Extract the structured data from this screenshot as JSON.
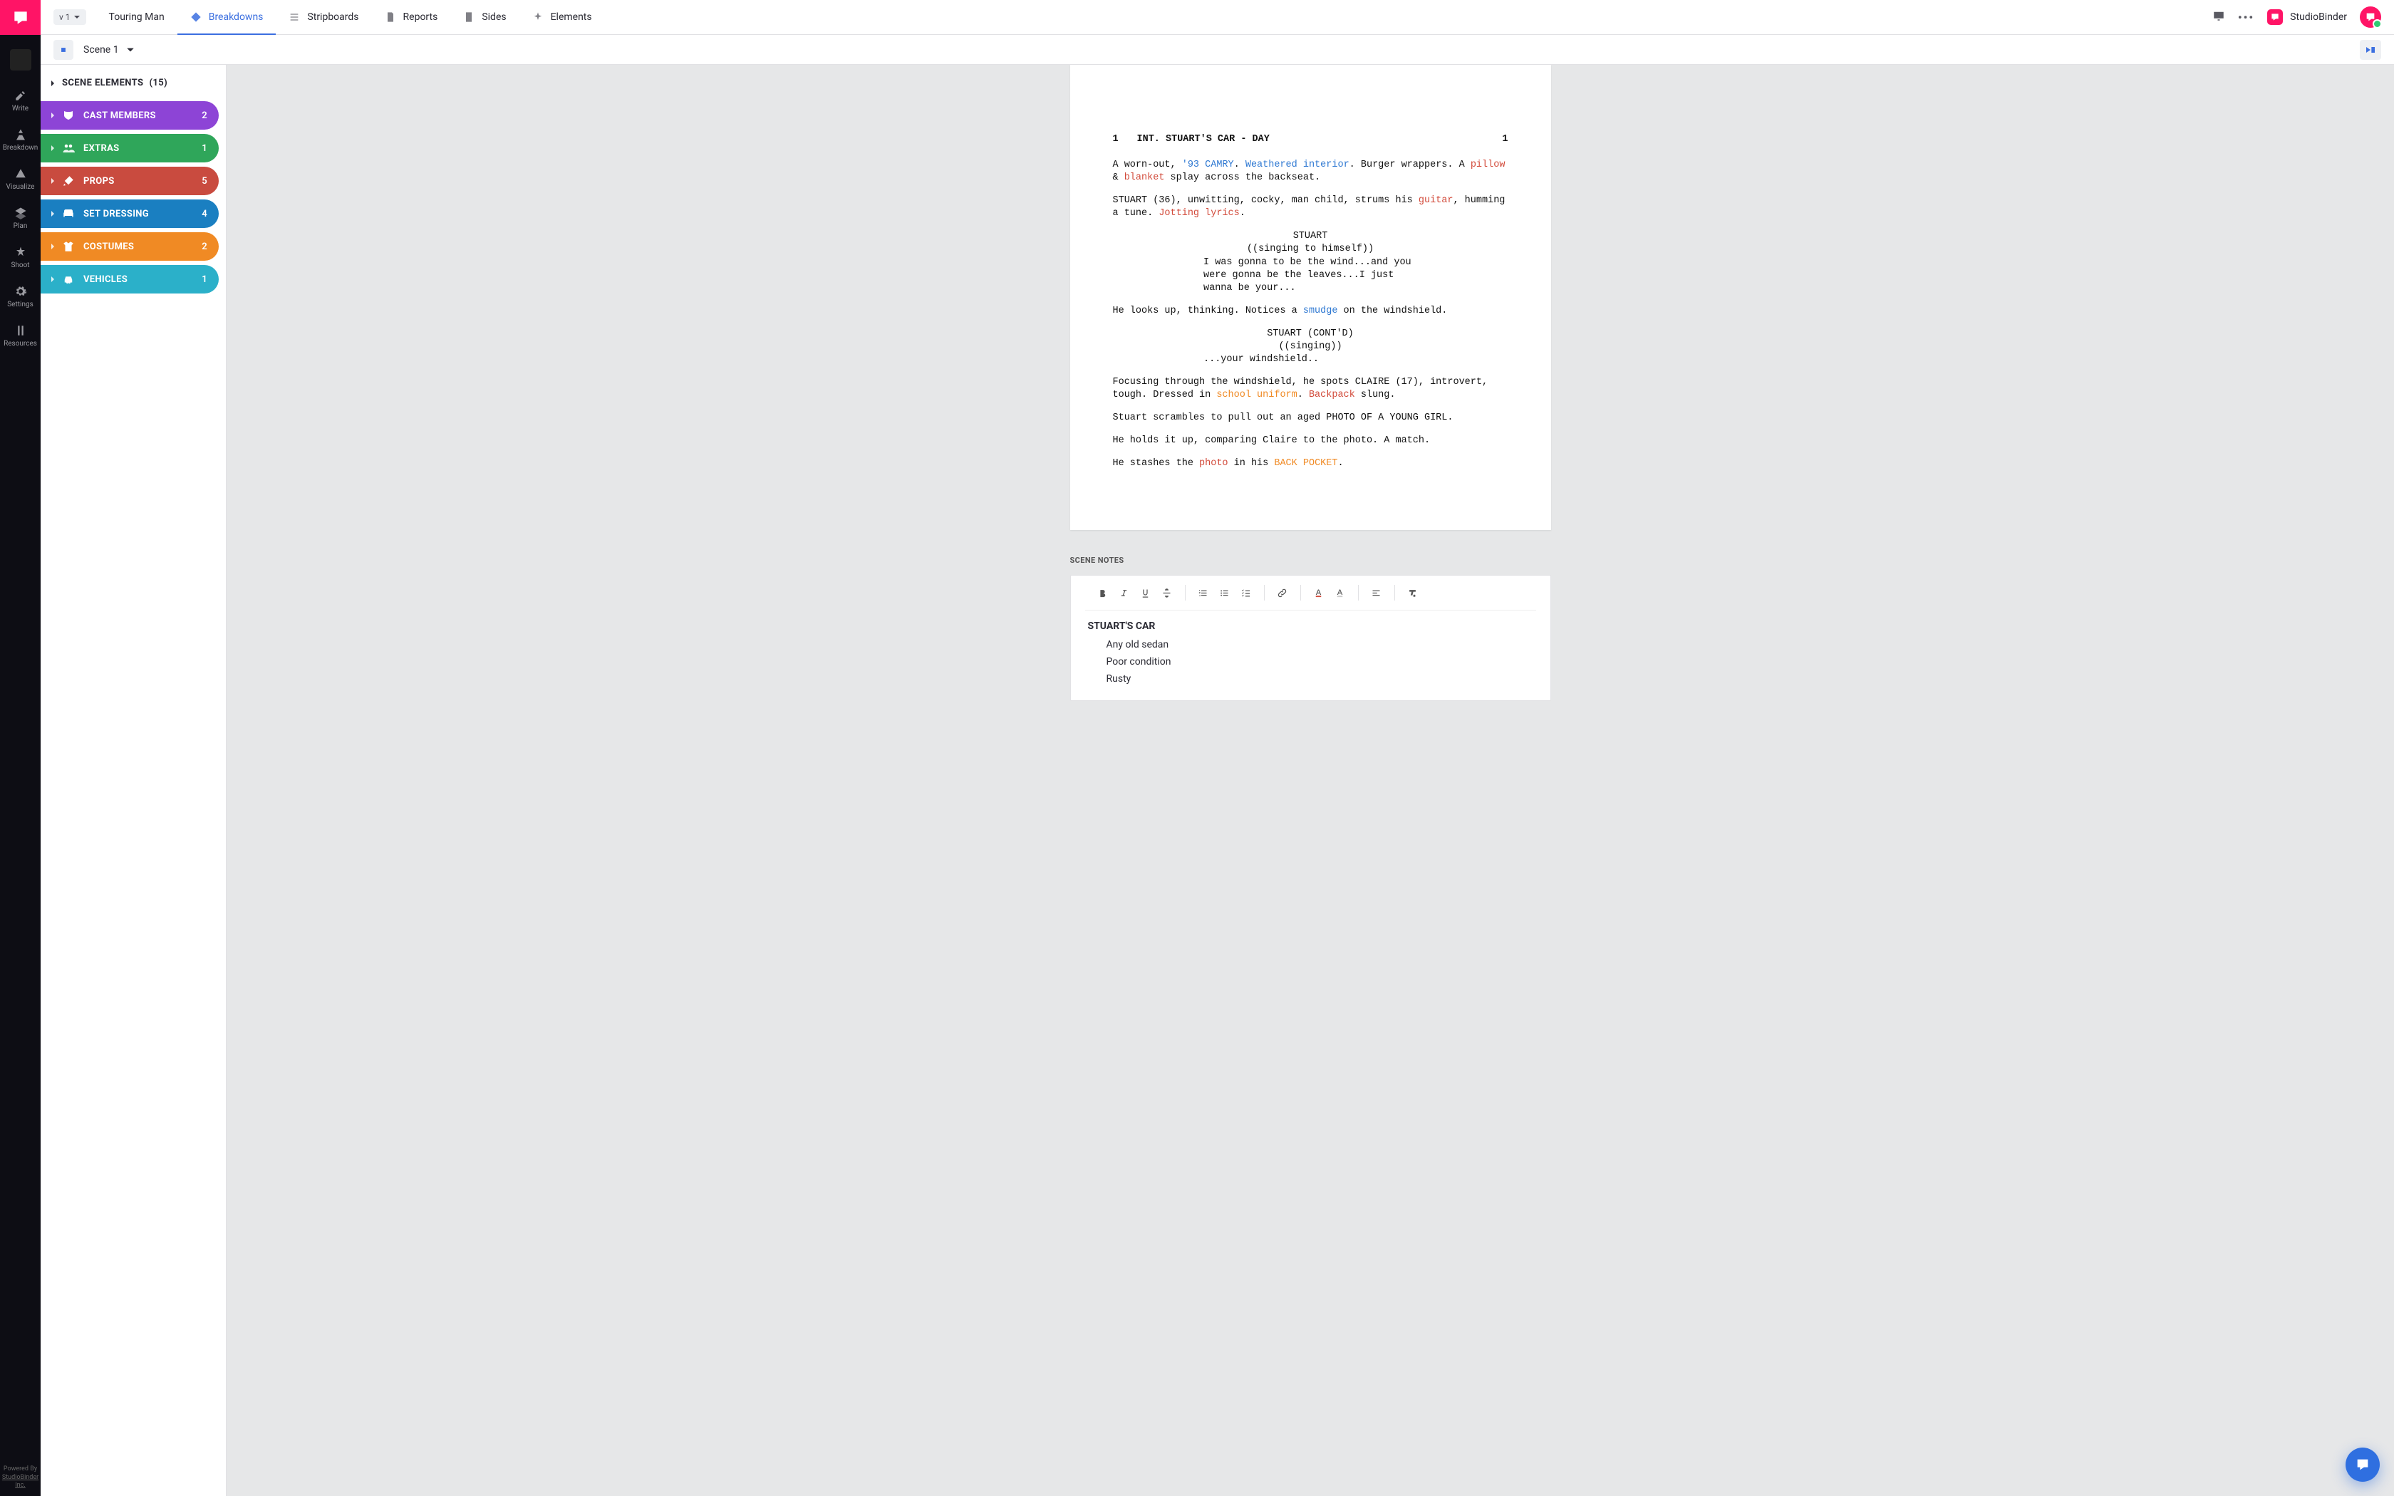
{
  "brand": {
    "name": "StudioBinder"
  },
  "rail": {
    "items": [
      {
        "label": "Write"
      },
      {
        "label": "Breakdown"
      },
      {
        "label": "Visualize"
      },
      {
        "label": "Plan"
      },
      {
        "label": "Shoot"
      },
      {
        "label": "Settings"
      },
      {
        "label": "Resources"
      }
    ],
    "footer_line1": "Powered By",
    "footer_line2": "StudioBinder Inc."
  },
  "topnav": {
    "version_label": "v 1",
    "project_title": "Touring Man",
    "tabs": [
      {
        "label": "Breakdowns"
      },
      {
        "label": "Stripboards"
      },
      {
        "label": "Reports"
      },
      {
        "label": "Sides"
      },
      {
        "label": "Elements"
      }
    ],
    "user_name": "StudioBinder"
  },
  "subnav": {
    "scene_label": "Scene 1"
  },
  "sidebar": {
    "header_label": "SCENE ELEMENTS",
    "header_count": "(15)",
    "categories": [
      {
        "label": "Cast Members",
        "count": "2"
      },
      {
        "label": "Extras",
        "count": "1"
      },
      {
        "label": "Props",
        "count": "5"
      },
      {
        "label": "Set Dressing",
        "count": "4"
      },
      {
        "label": "Costumes",
        "count": "2"
      },
      {
        "label": "Vehicles",
        "count": "1"
      }
    ]
  },
  "script": {
    "scene_number_left": "1",
    "scene_number_right": "1",
    "slugline": "INT. STUART'S CAR - DAY",
    "p1_a": "A worn-out, ",
    "p1_tag1": "'93 CAMRY",
    "p1_b": ". ",
    "p1_tag2": "Weathered interior",
    "p1_c": ". Burger wrappers. A ",
    "p1_tag3": "pillow",
    "p1_d": " & ",
    "p1_tag4": "blanket",
    "p1_e": " splay across the backseat.",
    "p2_a": "STUART (36), unwitting, cocky, man child, strums his ",
    "p2_tag1": "guitar",
    "p2_b": ", humming a tune. ",
    "p2_tag2": "Jotting lyrics",
    "p2_c": ".",
    "cue1_name": "STUART",
    "cue1_paren": "((singing to himself))",
    "cue1_line1": "I was gonna to be the wind...and you",
    "cue1_line2": "were gonna be the leaves...I just",
    "cue1_line3": "wanna be your...",
    "p3_a": "He looks up, thinking. Notices a ",
    "p3_tag1": "smudge",
    "p3_b": " on the windshield.",
    "cue2_name": "STUART (CONT'D)",
    "cue2_paren": "((singing))",
    "cue2_line1": "...your windshield..",
    "p4_a": "Focusing through the windshield, he spots CLAIRE (17), introvert, tough. Dressed in ",
    "p4_tag1": "school uniform",
    "p4_b": ". ",
    "p4_tag2": "Backpack",
    "p4_c": " slung.",
    "p5": "Stuart scrambles to pull out an aged PHOTO OF A YOUNG GIRL.",
    "p6": "He holds it up, comparing Claire to the photo. A match.",
    "p7_a": "He stashes the ",
    "p7_tag1": "photo",
    "p7_b": " in his ",
    "p7_tag2": "BACK POCKET",
    "p7_c": "."
  },
  "notes": {
    "section_title": "SCENE NOTES",
    "heading": "STUART'S CAR",
    "bullets": [
      "Any old sedan",
      "Poor condition",
      "Rusty"
    ]
  }
}
